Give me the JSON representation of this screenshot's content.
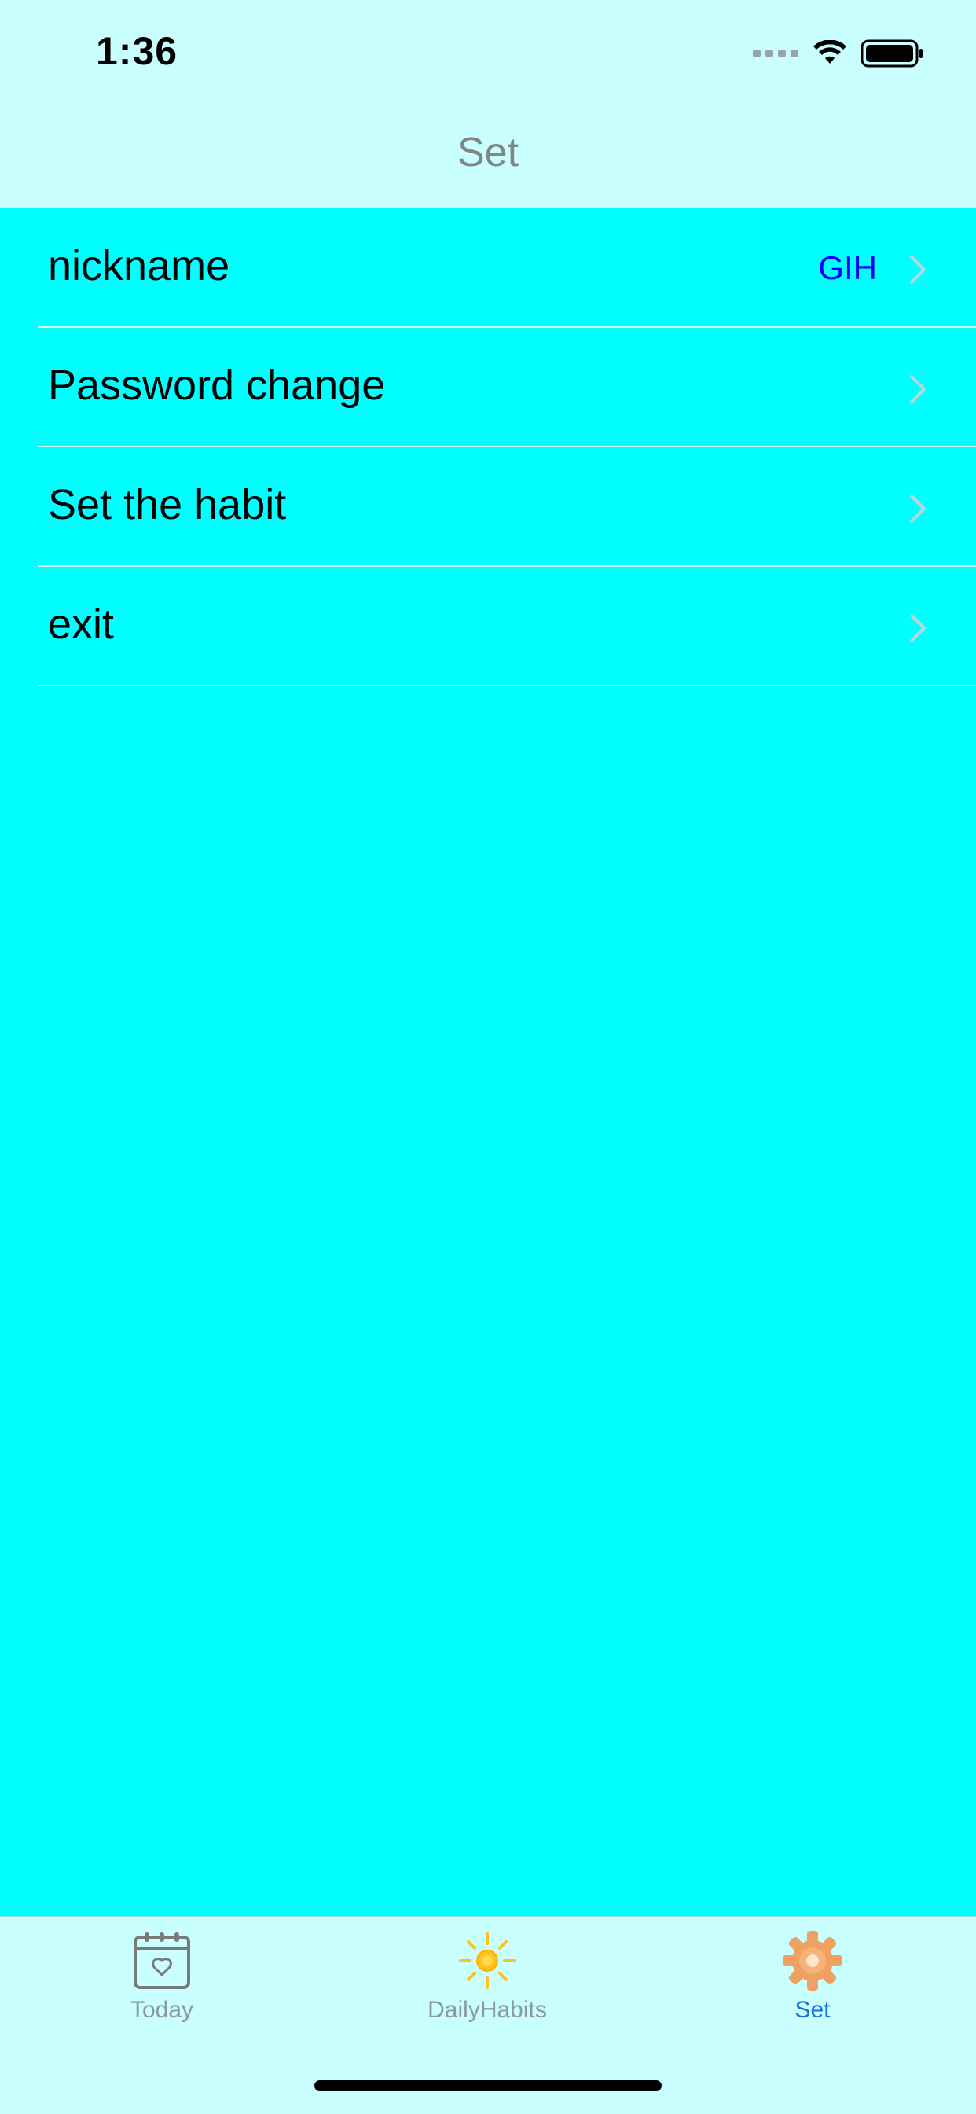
{
  "status_bar": {
    "time": "1:36",
    "icons": [
      "cellular-signal-icon",
      "wifi-icon",
      "battery-icon"
    ]
  },
  "nav": {
    "title": "Set"
  },
  "settings": {
    "items": [
      {
        "label": "nickname",
        "value": "GIH"
      },
      {
        "label": "Password change"
      },
      {
        "label": "Set the habit"
      },
      {
        "label": "exit"
      }
    ]
  },
  "tabbar": {
    "tabs": [
      {
        "label": "Today",
        "icon": "calendar-heart-icon",
        "active": false
      },
      {
        "label": "DailyHabits",
        "icon": "sun-icon",
        "active": false
      },
      {
        "label": "Set",
        "icon": "gear-icon",
        "active": true
      }
    ]
  },
  "colors": {
    "background": "#00FFFF",
    "bars": "#C9FFFF",
    "value_text": "#0A00FF",
    "active_tab": "#1A6EE0",
    "sun": "#FFC21A",
    "gear": "#F0A060"
  }
}
